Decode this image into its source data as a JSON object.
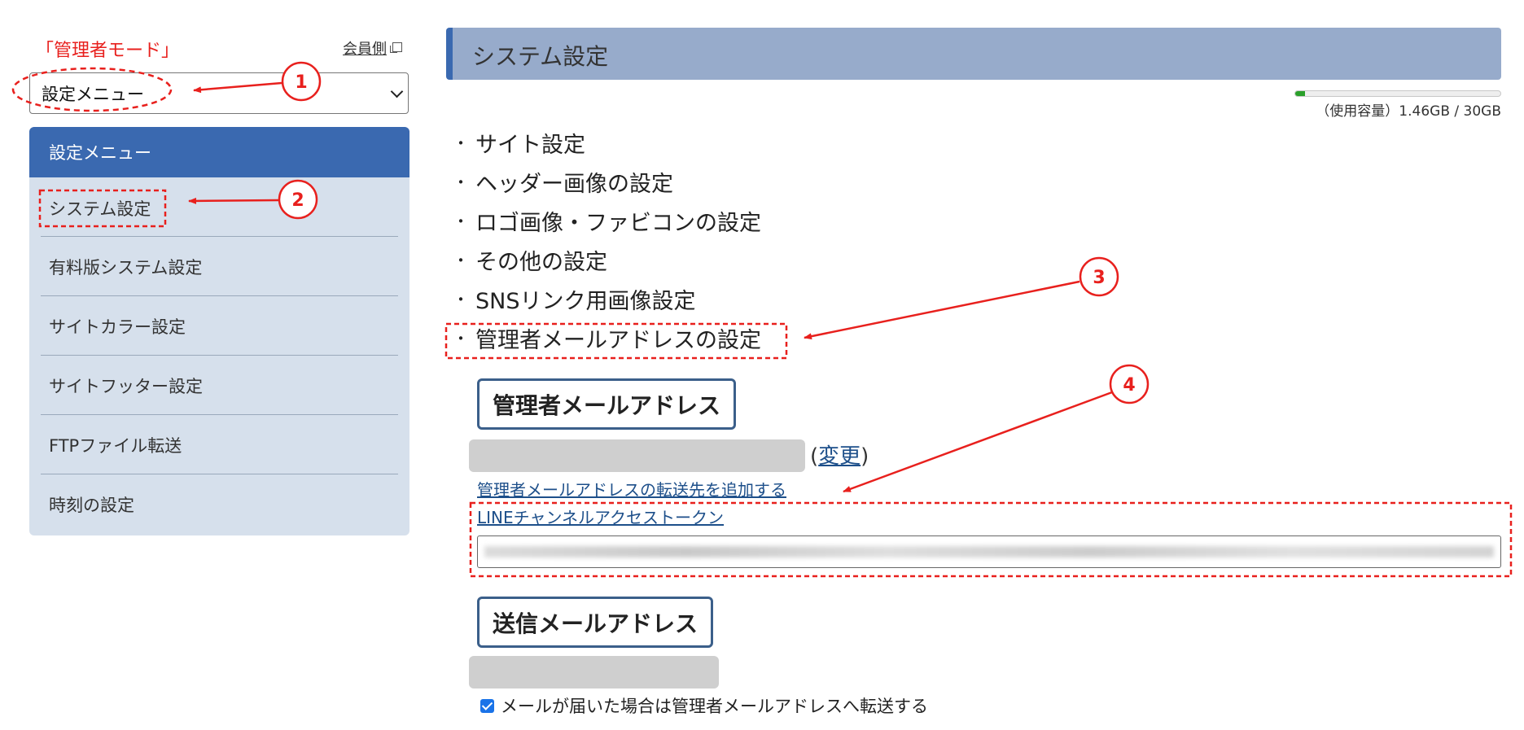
{
  "sidebar": {
    "mode_label": "「管理者モード」",
    "member_link": "会員側",
    "select_value": "設定メニュー",
    "panel_title": "設定メニュー",
    "items": [
      {
        "label": "システム設定"
      },
      {
        "label": "有料版システム設定"
      },
      {
        "label": "サイトカラー設定"
      },
      {
        "label": "サイトフッター設定"
      },
      {
        "label": "FTPファイル転送"
      },
      {
        "label": "時刻の設定"
      }
    ]
  },
  "main": {
    "title": "システム設定",
    "usage": {
      "text": "（使用容量）1.46GB / 30GB",
      "used_gb": 1.46,
      "total_gb": 30
    },
    "settings_list": [
      {
        "label": "サイト設定"
      },
      {
        "label": "ヘッダー画像の設定"
      },
      {
        "label": "ロゴ画像・ファビコンの設定"
      },
      {
        "label": "その他の設定"
      },
      {
        "label": "SNSリンク用画像設定"
      },
      {
        "label": "管理者メールアドレスの設定"
      }
    ],
    "bullet": "・",
    "admin_email": {
      "heading": "管理者メールアドレス",
      "open_paren": "(",
      "change_link": "変更",
      "close_paren": ")",
      "add_forward_link": "管理者メールアドレスの転送先を追加する",
      "line_token_link": "LINEチャンネルアクセストークン"
    },
    "send_email": {
      "heading": "送信メールアドレス",
      "forward_checkbox_label": "メールが届いた場合は管理者メールアドレスへ転送する",
      "forward_checked": true
    }
  },
  "annotations": {
    "color": "#e8201d",
    "callouts": [
      "1",
      "2",
      "3",
      "4"
    ]
  }
}
